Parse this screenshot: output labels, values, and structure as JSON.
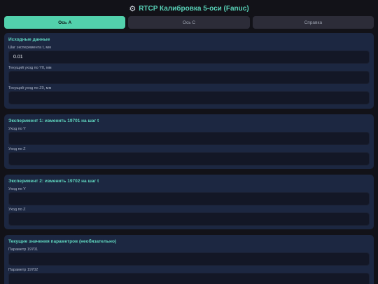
{
  "header": {
    "icon": "gear-icon",
    "title": "RTCP Калибровка 5-оси (Fanuc)"
  },
  "tabs": [
    {
      "label": "Ось A",
      "active": true
    },
    {
      "label": "Ось C",
      "active": false
    },
    {
      "label": "Справка",
      "active": false
    }
  ],
  "source": {
    "title": "Исходные данные",
    "step_label": "Шаг эксперимента t, мм",
    "step_value": "0.01",
    "y0_label": "Текущий уход по Y0, мм",
    "y0_value": "",
    "z0_label": "Текущий уход по Z0, мм",
    "z0_value": ""
  },
  "exp1": {
    "title": "Эксперимент 1: изменить 19701 на шаг t",
    "y_label": "Уход по Y",
    "z_label": "Уход по Z"
  },
  "exp2": {
    "title": "Эксперимент 2: изменить 19702 на шаг t",
    "y_label": "Уход по Y",
    "z_label": "Уход по Z"
  },
  "params": {
    "title": "Текущие значения параметров (необязательно)",
    "p1_label": "Параметр 19701",
    "p2_label": "Параметр 19702"
  },
  "colors": {
    "accent": "#52d1ac",
    "card_bg": "#1c2741",
    "page_bg": "#121218"
  }
}
